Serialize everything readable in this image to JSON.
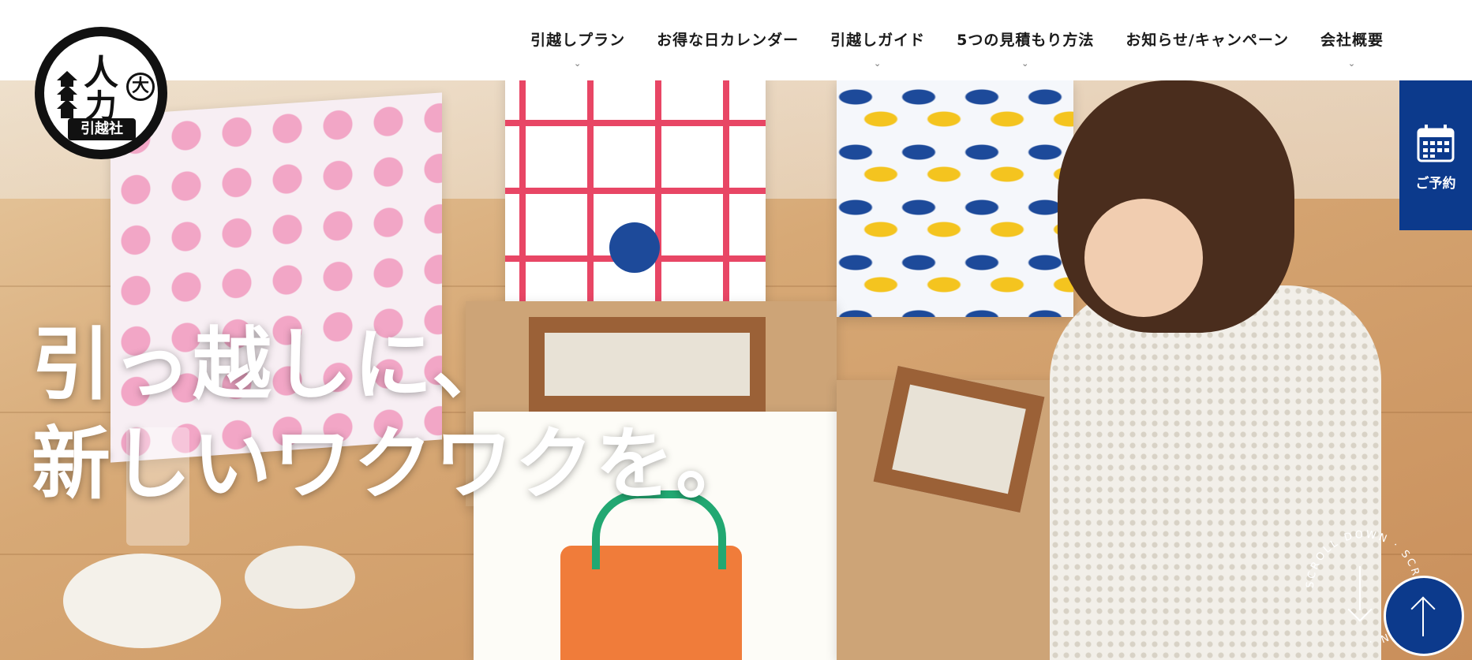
{
  "logo": {
    "line1": "人",
    "line2": "力",
    "badge": "大",
    "band": "引越社"
  },
  "nav": {
    "items": [
      {
        "label": "引越しプラン",
        "has_dropdown": true
      },
      {
        "label": "お得な日カレンダー",
        "has_dropdown": false
      },
      {
        "label": "引越しガイド",
        "has_dropdown": true
      },
      {
        "label": "5つの見積もり方法",
        "has_dropdown": true
      },
      {
        "label": "お知らせ/キャンペーン",
        "has_dropdown": false
      },
      {
        "label": "会社概要",
        "has_dropdown": true
      }
    ]
  },
  "hero": {
    "headline_line1": "引っ越しに、",
    "headline_line2": "新しいワクワクを。"
  },
  "reserve": {
    "label": "ご予約",
    "icon": "calendar-icon"
  },
  "scroll": {
    "text": "SCROLL DOWN · SCROLL DOWN · "
  },
  "colors": {
    "accent": "#0c3a8c",
    "header_bg": "#ffffff",
    "text": "#1a1a1a"
  }
}
